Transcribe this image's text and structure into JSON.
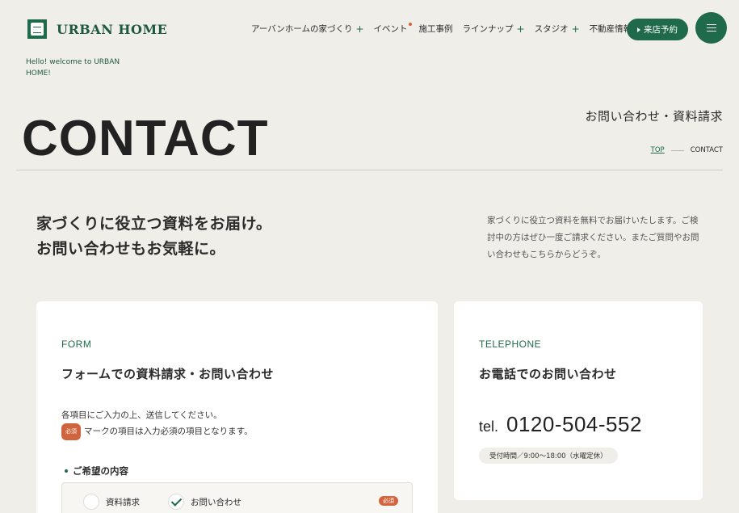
{
  "header": {
    "logo_text": "URBAN HOME",
    "logo_mark_text": "URBAN HOME",
    "nav": [
      {
        "label": "アーバンホームの家づくり",
        "has_plus": true
      },
      {
        "label": "イベント",
        "has_dot": true
      },
      {
        "label": "施工事例"
      },
      {
        "label": "ラインナップ",
        "has_plus": true
      },
      {
        "label": "スタジオ",
        "has_plus": true
      },
      {
        "label": "不動産情報",
        "has_plus": true
      }
    ],
    "plus_symbol": "+",
    "visit_button": "来店予約",
    "menu_icon": "hamburger-icon"
  },
  "welcome": "Hello! welcome to URBAN HOME!",
  "hero": {
    "title": "CONTACT",
    "jp_title": "お問い合わせ・資料請求",
    "breadcrumb_top": "TOP",
    "breadcrumb_current": "CONTACT"
  },
  "intro": {
    "lead_line1": "家づくりに役立つ資料をお届け。",
    "lead_line2": "お問い合わせもお気軽に。",
    "text": "家づくりに役立つ資料を無料でお届けいたします。ご検討中の方はぜひ一度ご請求ください。またご質問やお問い合わせもこちらからどうぞ。"
  },
  "form_card": {
    "eyebrow": "FORM",
    "title": "フォームでの資料請求・お問い合わせ",
    "desc_line1": "各項目にご入力の上、送信してください。",
    "required_badge": "必須",
    "desc_line2": "マークの項目は入力必須の項目となります。",
    "section_label": "ご希望の内容",
    "choices": [
      {
        "label": "資料請求",
        "checked": false
      },
      {
        "label": "お問い合わせ",
        "checked": true
      }
    ]
  },
  "tel_card": {
    "eyebrow": "TELEPHONE",
    "title": "お電話でのお問い合わせ",
    "prefix": "tel.",
    "number": "0120-504-552",
    "hours": "受付時間／9:00〜18:00（水曜定休）"
  },
  "colors": {
    "accent": "#1e6a4a",
    "required": "#d0643e",
    "background": "#f0eee9"
  }
}
